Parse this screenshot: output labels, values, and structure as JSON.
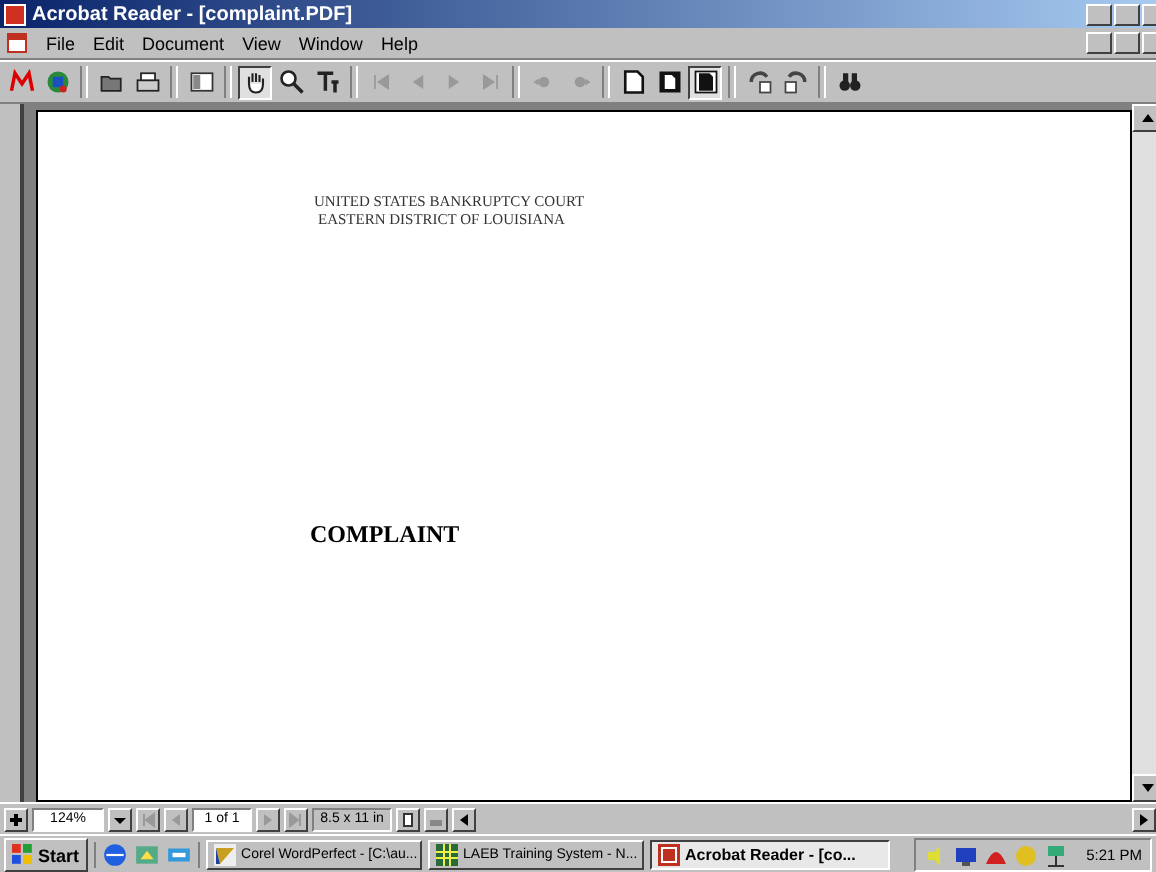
{
  "window": {
    "title": "Acrobat Reader - [complaint.PDF]"
  },
  "menu": [
    "File",
    "Edit",
    "Document",
    "View",
    "Window",
    "Help"
  ],
  "toolbar": [
    {
      "kind": "logo",
      "selected": false
    },
    {
      "kind": "globe",
      "selected": false
    },
    {
      "kind": "sep"
    },
    {
      "kind": "open",
      "selected": false
    },
    {
      "kind": "print",
      "selected": false
    },
    {
      "kind": "sep"
    },
    {
      "kind": "pane",
      "selected": false
    },
    {
      "kind": "sep"
    },
    {
      "kind": "hand",
      "selected": true
    },
    {
      "kind": "zoom",
      "selected": false
    },
    {
      "kind": "text",
      "selected": false
    },
    {
      "kind": "sep"
    },
    {
      "kind": "first",
      "selected": false
    },
    {
      "kind": "prev",
      "selected": false
    },
    {
      "kind": "next",
      "selected": false
    },
    {
      "kind": "last",
      "selected": false
    },
    {
      "kind": "sep"
    },
    {
      "kind": "back",
      "selected": false
    },
    {
      "kind": "forward",
      "selected": false
    },
    {
      "kind": "sep"
    },
    {
      "kind": "actual",
      "selected": false
    },
    {
      "kind": "fitpage",
      "selected": false
    },
    {
      "kind": "fitwidth",
      "selected": true
    },
    {
      "kind": "sep"
    },
    {
      "kind": "rotl",
      "selected": false
    },
    {
      "kind": "rotr",
      "selected": false
    },
    {
      "kind": "sep"
    },
    {
      "kind": "find",
      "selected": false
    }
  ],
  "document": {
    "heading": [
      "UNITED STATES BANKRUPTCY COURT",
      "EASTERN DISTRICT OF LOUISIANA"
    ],
    "title": "COMPLAINT"
  },
  "status_bar": {
    "zoom": "124%",
    "page": "1 of 1",
    "page_size": "8.5 x 11 in"
  },
  "taskbar": {
    "start": "Start",
    "tasks": [
      {
        "label": "Corel WordPerfect - [C:\\au...",
        "selected": false
      },
      {
        "label": "LAEB Training System - N...",
        "selected": false
      },
      {
        "label": "Acrobat Reader - [co...",
        "selected": true
      }
    ],
    "clock": "5:21 PM"
  }
}
